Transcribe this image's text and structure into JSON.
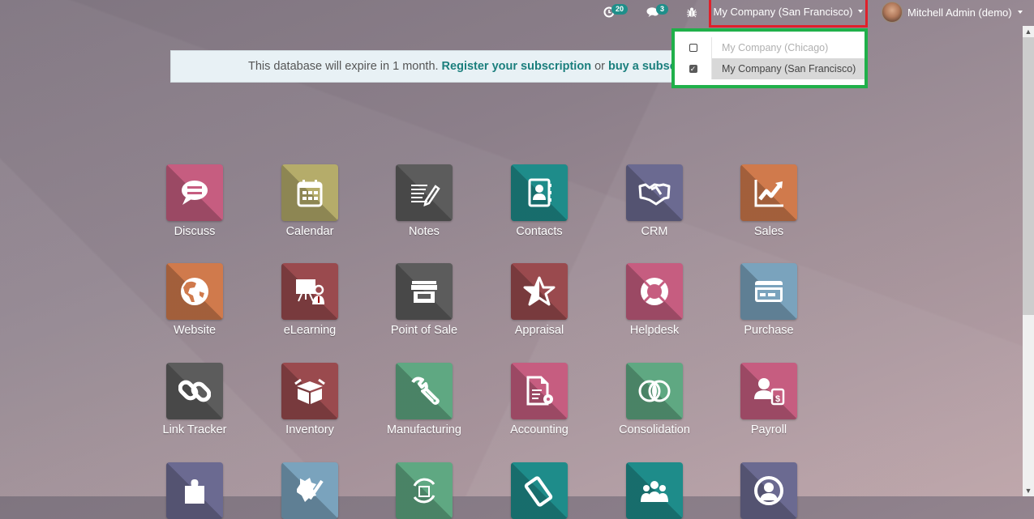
{
  "topbar": {
    "activity_badge": "20",
    "messages_badge": "3",
    "company_switcher": "My Company (San Francisco)",
    "user_name": "Mitchell Admin (demo)"
  },
  "company_dropdown": {
    "options": [
      {
        "label": "My Company (Chicago)",
        "checked": false
      },
      {
        "label": "My Company (San Francisco)",
        "checked": true
      }
    ],
    "highlight_color": "#20b04a"
  },
  "annotation": {
    "red_box_color": "#e0202a",
    "green_box_color": "#20b04a"
  },
  "banner": {
    "text": "This database will expire in 1 month.",
    "register_link": "Register your subscription",
    "or_text": "or",
    "buy_link": "buy a subscription"
  },
  "apps": [
    {
      "label": "Discuss",
      "icon": "chat-bubble-icon",
      "color": "#c65d80"
    },
    {
      "label": "Calendar",
      "icon": "calendar-icon",
      "color": "#b5ac6a"
    },
    {
      "label": "Notes",
      "icon": "notes-pencil-icon",
      "color": "#5c5c5c"
    },
    {
      "label": "Contacts",
      "icon": "address-book-icon",
      "color": "#1e8c8a"
    },
    {
      "label": "CRM",
      "icon": "handshake-icon",
      "color": "#6b6a91"
    },
    {
      "label": "Sales",
      "icon": "chart-trend-icon",
      "color": "#d07a4c"
    },
    {
      "label": "Website",
      "icon": "globe-icon",
      "color": "#d07a4c"
    },
    {
      "label": "eLearning",
      "icon": "teacher-board-icon",
      "color": "#9a4a4e"
    },
    {
      "label": "Point of Sale",
      "icon": "shop-icon",
      "color": "#5c5c5c"
    },
    {
      "label": "Appraisal",
      "icon": "half-star-icon",
      "color": "#9a4a4e"
    },
    {
      "label": "Helpdesk",
      "icon": "lifebuoy-icon",
      "color": "#c65d80"
    },
    {
      "label": "Purchase",
      "icon": "credit-card-icon",
      "color": "#7aa3bd"
    },
    {
      "label": "Link Tracker",
      "icon": "link-icon",
      "color": "#5c5c5c"
    },
    {
      "label": "Inventory",
      "icon": "box-icon",
      "color": "#9a4a4e"
    },
    {
      "label": "Manufacturing",
      "icon": "wrench-icon",
      "color": "#5fa882"
    },
    {
      "label": "Accounting",
      "icon": "document-gear-icon",
      "color": "#c65d80"
    },
    {
      "label": "Consolidation",
      "icon": "overlapping-circles-icon",
      "color": "#5fa882"
    },
    {
      "label": "Payroll",
      "icon": "person-dollar-icon",
      "color": "#c65d80"
    },
    {
      "label": "",
      "icon": "puzzle-icon",
      "color": "#6b6a91"
    },
    {
      "label": "",
      "icon": "badge-pencil-icon",
      "color": "#7aa3bd"
    },
    {
      "label": "",
      "icon": "recycle-box-icon",
      "color": "#5fa882"
    },
    {
      "label": "",
      "icon": "ticket-icon",
      "color": "#1e8c8a"
    },
    {
      "label": "",
      "icon": "group-icon",
      "color": "#1e8c8a"
    },
    {
      "label": "",
      "icon": "user-circle-icon",
      "color": "#6b6a91"
    }
  ]
}
